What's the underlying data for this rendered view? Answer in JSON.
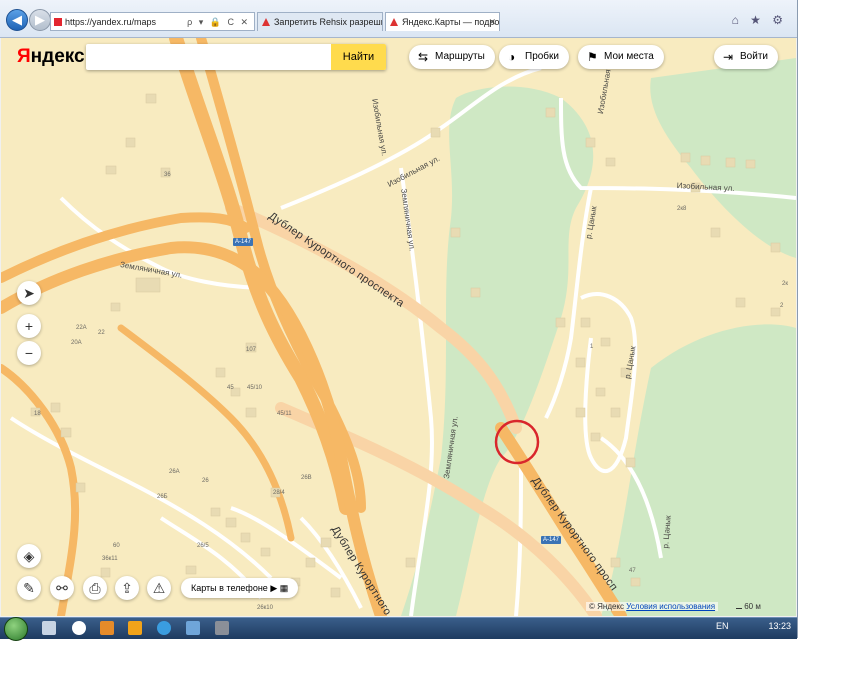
{
  "browser": {
    "url": "https://yandex.ru/maps",
    "url_tools": "ρ ▾ 🔒 C ✕",
    "tabs": [
      {
        "title": "Запретить Rehsix разрешив",
        "close": "✕"
      },
      {
        "title": "Яндекс.Карты — подробна",
        "close": "✕"
      }
    ],
    "window_controls": "⌂ ★ ⚙",
    "back_icon": "back-arrow-icon",
    "forward_icon": "forward-arrow-icon"
  },
  "header": {
    "logo_red": "Я",
    "logo_rest": "ндекс",
    "search_placeholder": "",
    "search_button": "Найти",
    "routes_label": "Маршруты",
    "traffic_label": "Пробки",
    "places_label": "Мои места",
    "login_label": "Войти"
  },
  "map": {
    "streets": [
      {
        "name": "Изобильная ул."
      },
      {
        "name": "Изобильная ул."
      },
      {
        "name": "Земляничная ул."
      },
      {
        "name": "Земляничная ул."
      },
      {
        "name": "Земляничная ул."
      },
      {
        "name": "Изобильная ул."
      },
      {
        "name": "р. Цанык"
      },
      {
        "name": "р. Цанык"
      },
      {
        "name": "р. Цанык"
      },
      {
        "name": "Изобильная ул."
      }
    ],
    "main_roads": [
      {
        "name": "Дублер Курортного проспекта"
      },
      {
        "name": "Дублер Курортного просп"
      },
      {
        "name": "Дублер Курортного"
      }
    ],
    "route_shields": [
      "A-147",
      "A-147"
    ],
    "house_numbers": [
      "36",
      "22А",
      "22",
      "20А",
      "107",
      "45",
      "45/10",
      "45/11",
      "18",
      "26А",
      "26Б",
      "26",
      "26В",
      "28/4",
      "26/5",
      "36к11",
      "60",
      "26к10",
      "2к8",
      "1",
      "47",
      "2к",
      "2"
    ],
    "marker": "red-circle-marker"
  },
  "controls": {
    "locate_icon": "locate-arrow-icon",
    "zoom_in": "+",
    "zoom_out": "−",
    "layers_icon": "layers-icon",
    "ruler_icon": "ruler-icon",
    "binoculars_icon": "panorama-icon",
    "print_icon": "print-icon",
    "share_icon": "share-icon",
    "warning_icon": "report-error-icon",
    "phone_promo": "Карты в телефоне",
    "phone_promo_icons": "  ▶ ▦"
  },
  "footer": {
    "copyright": "© Яндекс",
    "terms": "Условия использования",
    "scale": "60 м"
  },
  "taskbar": {
    "lang": "EN",
    "time": "13:23"
  },
  "colors": {
    "land": "#f8ebc0",
    "park": "#cfe8c4",
    "highway": "#f6b865",
    "highway_light": "#f9d4a6",
    "marker": "#d9262c",
    "search_button": "#ffdb4d"
  }
}
